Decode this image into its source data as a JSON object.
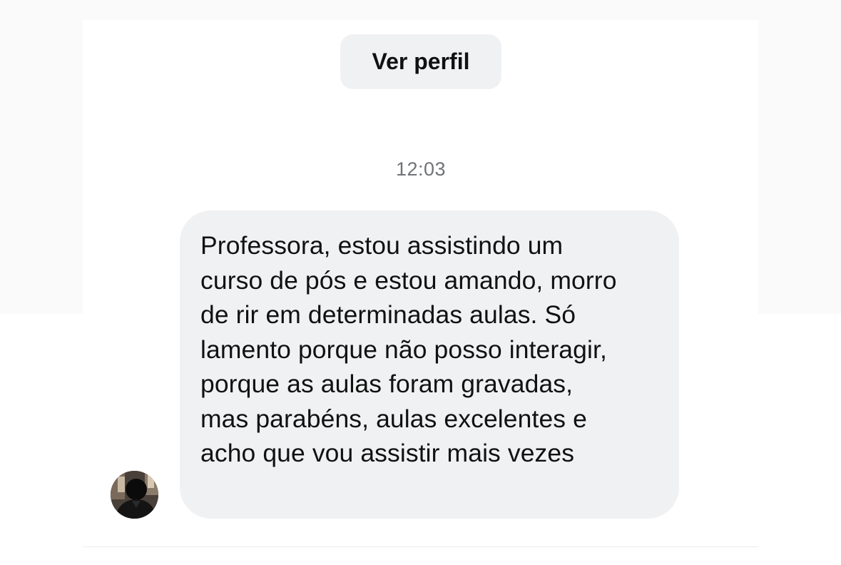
{
  "profile_button": {
    "label": "Ver perfil"
  },
  "conversation": {
    "timestamp": "12:03",
    "messages": [
      {
        "sender": "incoming",
        "avatar_icon": "user-avatar-icon",
        "text": "Professora, estou assistindo um\ncurso de pós e estou amando, morro\nde rir em determinadas aulas. Só\nlamento porque não posso interagir,\nporque as aulas foram gravadas,\nmas parabéns, aulas excelentes e\nacho que vou assistir mais vezes"
      }
    ]
  },
  "colors": {
    "bubble_background": "#f0f1f3",
    "button_background": "#f0f1f3",
    "timestamp_text": "#707378",
    "primary_text": "#111111"
  }
}
